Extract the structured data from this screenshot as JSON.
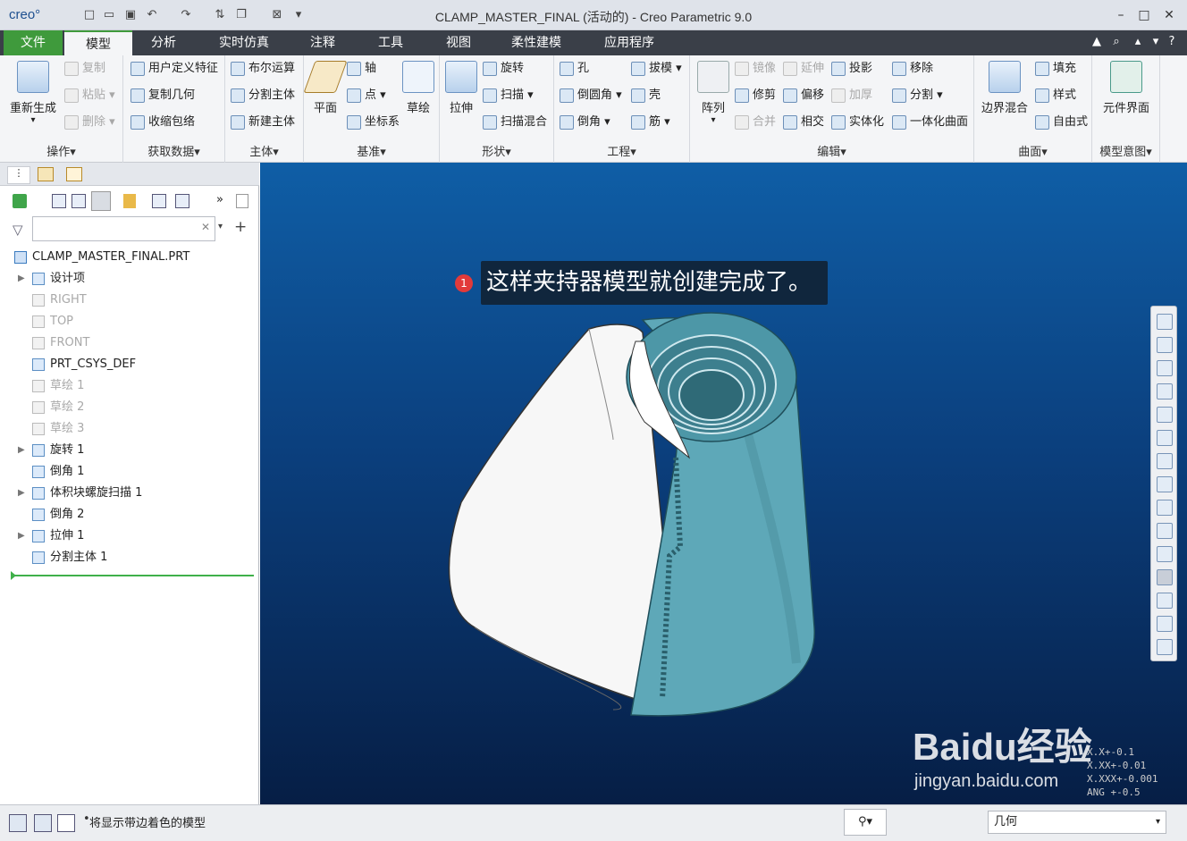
{
  "window": {
    "app_logo": "creo°",
    "title": "CLAMP_MASTER_FINAL (活动的) - Creo Parametric 9.0"
  },
  "menu": {
    "tabs": [
      "文件",
      "模型",
      "分析",
      "实时仿真",
      "注释",
      "工具",
      "视图",
      "柔性建模",
      "应用程序"
    ],
    "active": "模型"
  },
  "ribbon": {
    "operations": {
      "label": "操作",
      "regen": "重新生成",
      "copy": "复制",
      "paste": "粘贴",
      "delete": "删除"
    },
    "get_data": {
      "label": "获取数据",
      "udf": "用户定义特征",
      "copy_geom": "复制几何",
      "shrinkwrap": "收缩包络"
    },
    "body": {
      "label": "主体",
      "boolean": "布尔运算",
      "split_body": "分割主体",
      "new_body": "新建主体"
    },
    "datum": {
      "label": "基准",
      "plane": "平面",
      "axis": "轴",
      "point": "点",
      "csys": "坐标系",
      "sketch": "草绘"
    },
    "shapes": {
      "label": "形状",
      "extrude": "拉伸",
      "revolve": "旋转",
      "sweep": "扫描",
      "swept_blend": "扫描混合"
    },
    "engineering": {
      "label": "工程",
      "hole": "孔",
      "round": "倒圆角",
      "chamfer": "倒角",
      "draft": "拔模",
      "shell": "壳",
      "rib": "筋"
    },
    "editing": {
      "label": "编辑",
      "pattern": "阵列",
      "mirror": "镜像",
      "extend": "延伸",
      "project": "投影",
      "move": "移除",
      "trim": "修剪",
      "offset": "偏移",
      "thicken": "加厚",
      "split": "分割",
      "merge": "合并",
      "intersect": "相交",
      "solidify": "实体化",
      "unified": "一体化曲面"
    },
    "surfaces": {
      "label": "曲面",
      "boundary": "边界混合",
      "fill": "填充",
      "style": "样式",
      "freestyle": "自由式"
    },
    "intent": {
      "label": "模型意图",
      "component_interface": "元件界面"
    }
  },
  "model_tree": {
    "root": "CLAMP_MASTER_FINAL.PRT",
    "items": [
      {
        "label": "设计项",
        "expandable": true,
        "dim": false
      },
      {
        "label": "RIGHT",
        "expandable": false,
        "dim": true
      },
      {
        "label": "TOP",
        "expandable": false,
        "dim": true
      },
      {
        "label": "FRONT",
        "expandable": false,
        "dim": true
      },
      {
        "label": "PRT_CSYS_DEF",
        "expandable": false,
        "dim": false
      },
      {
        "label": "草绘 1",
        "expandable": false,
        "dim": true
      },
      {
        "label": "草绘 2",
        "expandable": false,
        "dim": true
      },
      {
        "label": "草绘 3",
        "expandable": false,
        "dim": true
      },
      {
        "label": "旋转 1",
        "expandable": true,
        "dim": false
      },
      {
        "label": "倒角 1",
        "expandable": false,
        "dim": false
      },
      {
        "label": "体积块螺旋扫描 1",
        "expandable": true,
        "dim": false
      },
      {
        "label": "倒角 2",
        "expandable": false,
        "dim": false
      },
      {
        "label": "拉伸 1",
        "expandable": true,
        "dim": false
      },
      {
        "label": "分割主体 1",
        "expandable": false,
        "dim": false
      }
    ]
  },
  "annotation": {
    "badge": "1",
    "text": "这样夹持器模型就创建完成了。"
  },
  "precision": [
    "+-0.1",
    "+-0.01",
    "+-0.001",
    "ANG +-0.5"
  ],
  "precision_prefix": [
    "X.X",
    "X.XX",
    "X.XXX",
    ""
  ],
  "watermark": {
    "brand": "Baidu经验",
    "url": "jingyan.baidu.com"
  },
  "status": {
    "message": "将显示带边着色的模型",
    "selection_filter": "几何"
  },
  "colors": {
    "file_tab": "#3f9a3c",
    "viewport_top": "#0f5ea6",
    "viewport_bottom": "#061e45",
    "model_teal": "#5ea8b8"
  }
}
